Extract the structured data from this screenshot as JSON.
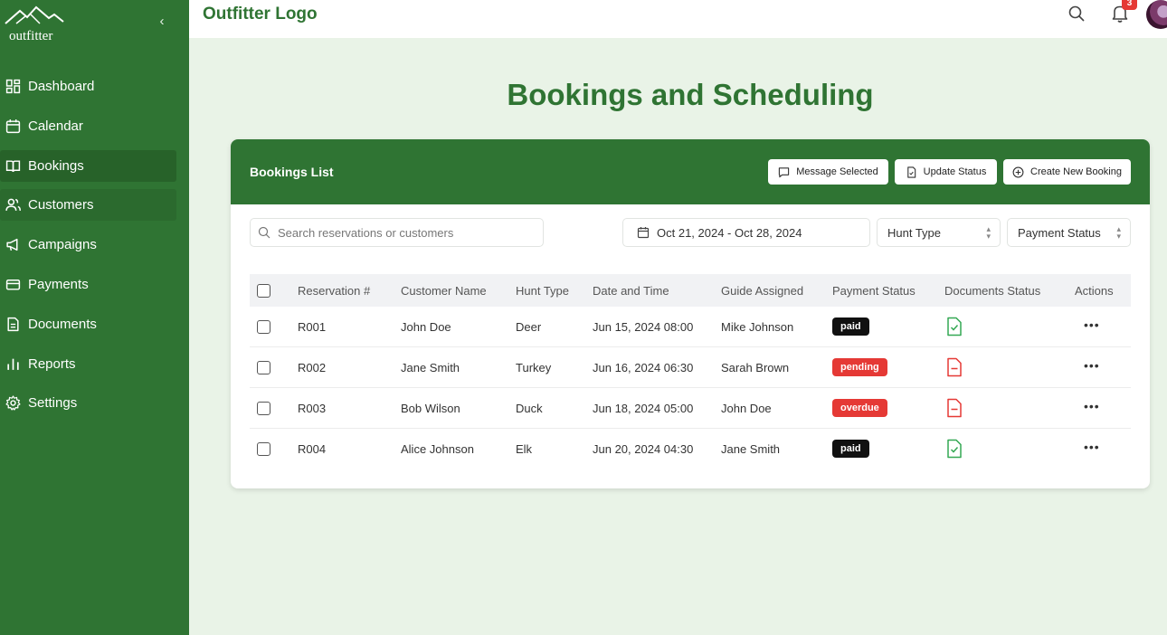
{
  "app": {
    "logo_text": "outfitter",
    "header_title": "Outfitter Logo",
    "notification_count": "3"
  },
  "sidebar": {
    "items": [
      {
        "label": "Dashboard",
        "icon": "dashboard-icon"
      },
      {
        "label": "Calendar",
        "icon": "calendar-icon"
      },
      {
        "label": "Bookings",
        "icon": "book-icon"
      },
      {
        "label": "Customers",
        "icon": "users-icon"
      },
      {
        "label": "Campaigns",
        "icon": "megaphone-icon"
      },
      {
        "label": "Payments",
        "icon": "credit-card-icon"
      },
      {
        "label": "Documents",
        "icon": "document-icon"
      },
      {
        "label": "Reports",
        "icon": "bar-chart-icon"
      },
      {
        "label": "Settings",
        "icon": "gear-icon"
      }
    ]
  },
  "main": {
    "page_title": "Bookings and Scheduling",
    "card_title": "Bookings List",
    "buttons": {
      "message": "Message Selected",
      "update": "Update Status",
      "create": "Create New Booking"
    },
    "search_placeholder": "Search reservations or customers",
    "date_range": "Oct 21, 2024 - Oct 28, 2024",
    "hunt_type_filter": "Hunt Type",
    "payment_status_filter": "Payment Status",
    "columns": [
      "Reservation #",
      "Customer Name",
      "Hunt Type",
      "Date and Time",
      "Guide Assigned",
      "Payment Status",
      "Documents Status",
      "Actions"
    ],
    "rows": [
      {
        "res": "R001",
        "customer": "John Doe",
        "hunt": "Deer",
        "datetime": "Jun 15, 2024 08:00",
        "guide": "Mike Johnson",
        "payment": "paid",
        "docs": "complete"
      },
      {
        "res": "R002",
        "customer": "Jane Smith",
        "hunt": "Turkey",
        "datetime": "Jun 16, 2024 06:30",
        "guide": "Sarah Brown",
        "payment": "pending",
        "docs": "missing"
      },
      {
        "res": "R003",
        "customer": "Bob Wilson",
        "hunt": "Duck",
        "datetime": "Jun 18, 2024 05:00",
        "guide": "John Doe",
        "payment": "overdue",
        "docs": "missing"
      },
      {
        "res": "R004",
        "customer": "Alice Johnson",
        "hunt": "Elk",
        "datetime": "Jun 20, 2024 04:30",
        "guide": "Jane Smith",
        "payment": "paid",
        "docs": "complete"
      }
    ],
    "actions_glyph": "•••"
  },
  "colors": {
    "brand_green": "#2f7433",
    "paid": "#111111",
    "alert_red": "#e53935",
    "doc_ok": "#34a853",
    "doc_missing": "#e53935"
  }
}
